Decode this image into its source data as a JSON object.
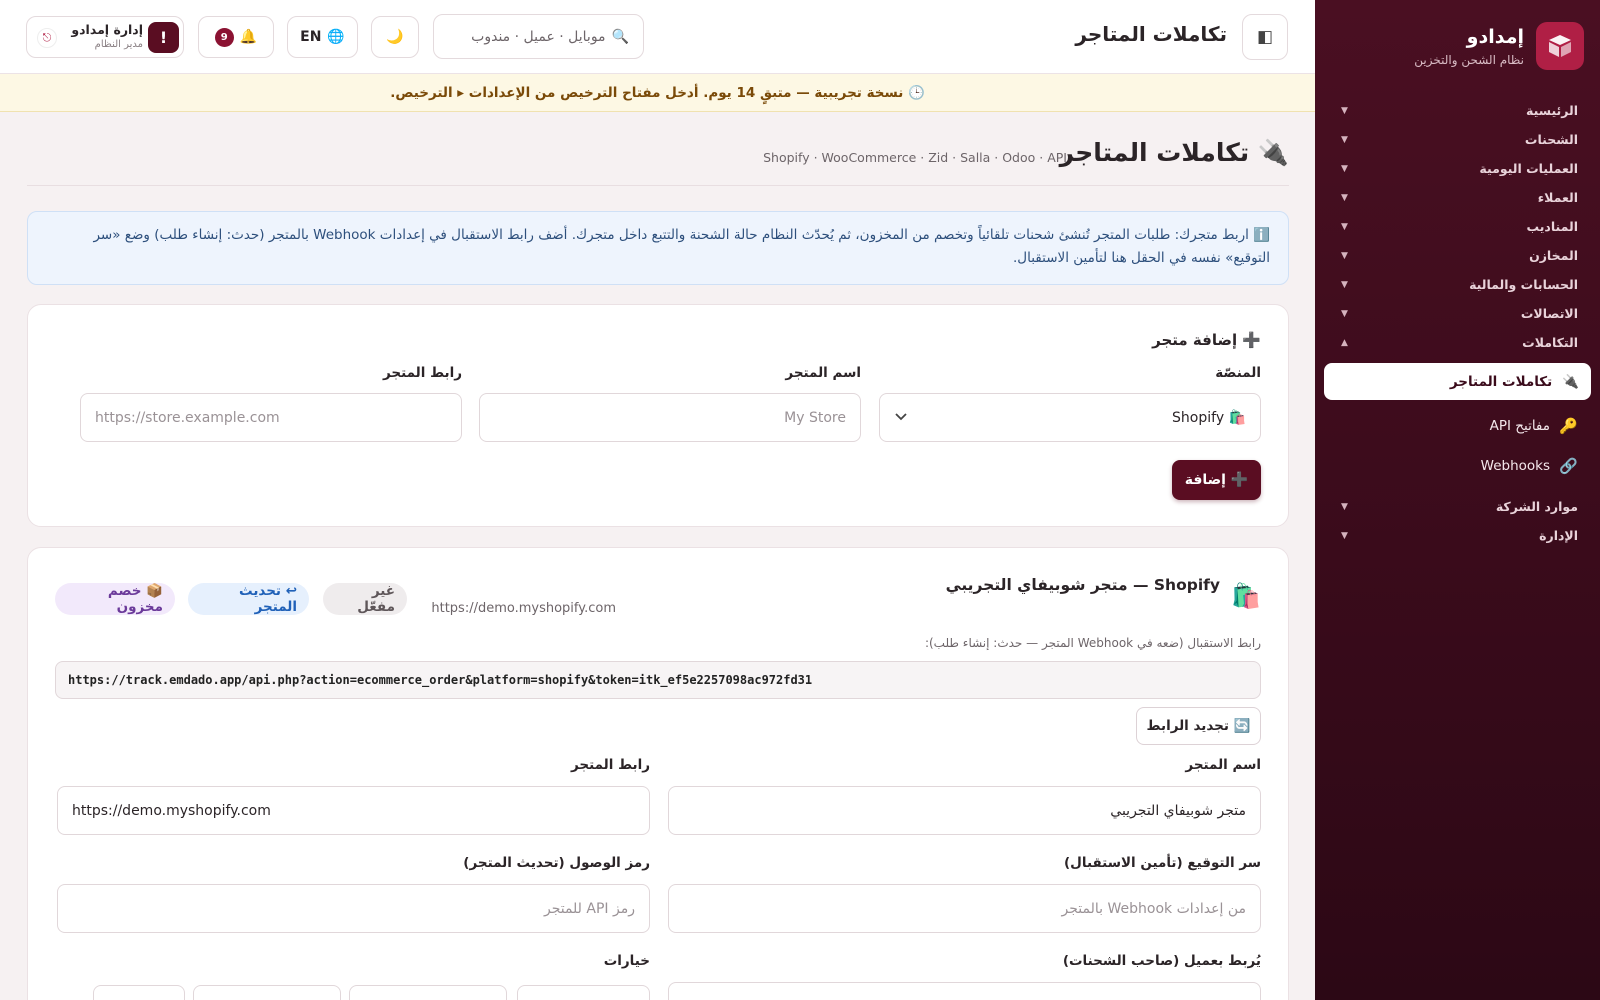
{
  "sidebar": {
    "brand_name": "إمدادو",
    "brand_sub": "نظام الشحن والتخزين",
    "groups_top": [
      {
        "label": "الرئيسية"
      },
      {
        "label": "الشحنات"
      },
      {
        "label": "العمليات اليومية"
      },
      {
        "label": "العملاء"
      },
      {
        "label": "المناديب"
      },
      {
        "label": "المخازن"
      },
      {
        "label": "الحسابات والمالية"
      },
      {
        "label": "الاتصالات"
      },
      {
        "label": "التكاملات"
      }
    ],
    "active_item": {
      "label": "تكاملات المتاجر",
      "icon": "plug-icon"
    },
    "sub_items": [
      {
        "label": "مفاتيح API",
        "icon": "key-icon"
      },
      {
        "label": "Webhooks",
        "icon": "link-icon"
      }
    ],
    "groups_bottom": [
      {
        "label": "موارد الشركة"
      },
      {
        "label": "الإدارة"
      }
    ]
  },
  "topbar": {
    "title": "تكاملات المتاجر",
    "search_placeholder": "موبايل · عميل · مندوب",
    "lang_label": "EN",
    "notif_count": "9",
    "user_name": "إدارة إمدادو",
    "user_role": "مدير النظام",
    "user_initial": "!"
  },
  "trial_banner": "🕒 نسخة تجريبية — متبقٍ 14 يوم. أدخل مفتاح الترخيص من الإعدادات ▸ الترخيص.",
  "page": {
    "title": "تكاملات المتاجر",
    "subtitle": "Shopify · WooCommerce · Zid · Salla · Odoo · API",
    "info_text": "ℹ️ اربط متجرك: طلبات المتجر تُنشئ شحنات تلقائياً وتخصم من المخزون، ثم يُحدّث النظام حالة الشحنة والتتبع داخل متجرك. أضف رابط الاستقبال في إعدادات Webhook بالمتجر (حدث: إنشاء طلب) وضع «سر التوقيع» نفسه في الحقل هنا لتأمين الاستقبال."
  },
  "add_store": {
    "title": "➕ إضافة متجر",
    "platform_label": "المنصّة",
    "platform_value": "🛍️ Shopify",
    "name_label": "اسم المتجر",
    "name_placeholder": "My Store",
    "url_label": "رابط المتجر",
    "url_placeholder": "https://store.example.com",
    "add_button": "➕ إضافة"
  },
  "store": {
    "name": "Shopify — متجر شوبيفاي التجريبي",
    "url": "https://demo.myshopify.com",
    "status": "غير مفعّل",
    "sync_label": "↩ تحديث المتجر",
    "stock_label": "📦 خصم مخزون",
    "webhook_label": "رابط الاستقبال (ضعه في Webhook المتجر — حدث: إنشاء طلب):",
    "webhook_url": "https://track.emdado.app/api.php?action=ecommerce_order&platform=shopify&token=itk_ef5e2257098ac972fd31",
    "regen_label": "🔄 تجديد الرابط",
    "name_label": "اسم المتجر",
    "name_value": "متجر شوبيفاي التجريبي",
    "url_label": "رابط المتجر",
    "url_value": "https://demo.myshopify.com",
    "secret_label": "سر التوقيع (تأمين الاستقبال)",
    "secret_placeholder": "من إعدادات Webhook بالمتجر",
    "token_label": "رمز الوصول (تحديث المتجر)",
    "token_placeholder": "رمز API للمتجر",
    "client_label": "يُربط بعميل (صاحب الشحنات)",
    "options_label": "خيارات"
  },
  "colors": {
    "brand": "#5a0d22",
    "sidebar_bg": "#3a0b1b",
    "accent": "#b01f45"
  }
}
